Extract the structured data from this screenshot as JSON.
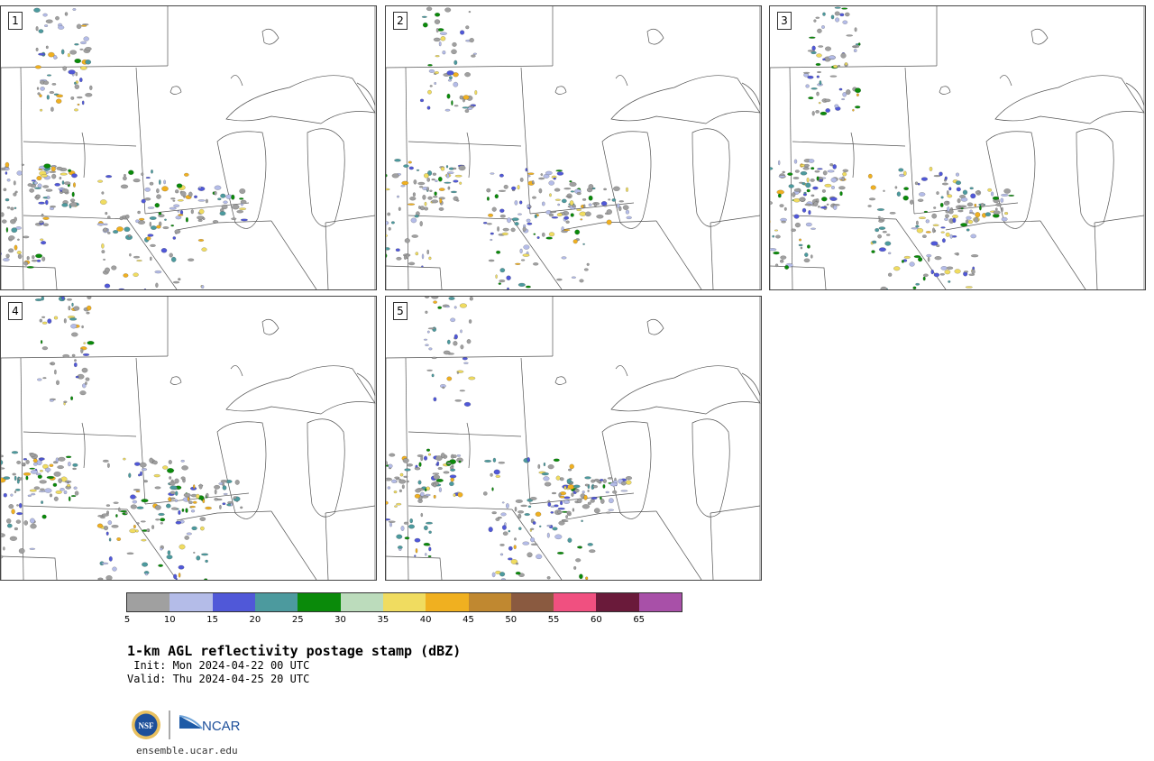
{
  "panels": [
    {
      "label": "1"
    },
    {
      "label": "2"
    },
    {
      "label": "3"
    },
    {
      "label": "4"
    },
    {
      "label": "5"
    }
  ],
  "colorbar": {
    "colors": [
      "#a0a0a0",
      "#b4bce8",
      "#5058d8",
      "#4c9a9e",
      "#0a8a0a",
      "#bcdcbc",
      "#f0dc60",
      "#f0b020",
      "#c08830",
      "#8a5a40",
      "#f05080",
      "#6a1a3a",
      "#a850a8"
    ],
    "ticks": [
      "5",
      "10",
      "15",
      "20",
      "25",
      "30",
      "35",
      "40",
      "45",
      "50",
      "55",
      "60",
      "65"
    ]
  },
  "title": "1-km AGL reflectivity postage stamp (dBZ)",
  "init": " Init: Mon 2024-04-22 00 UTC",
  "valid": "Valid: Thu 2024-04-25 20 UTC",
  "logo": {
    "left": "NSF",
    "right": "NCAR"
  },
  "site": "ensemble.ucar.edu"
}
